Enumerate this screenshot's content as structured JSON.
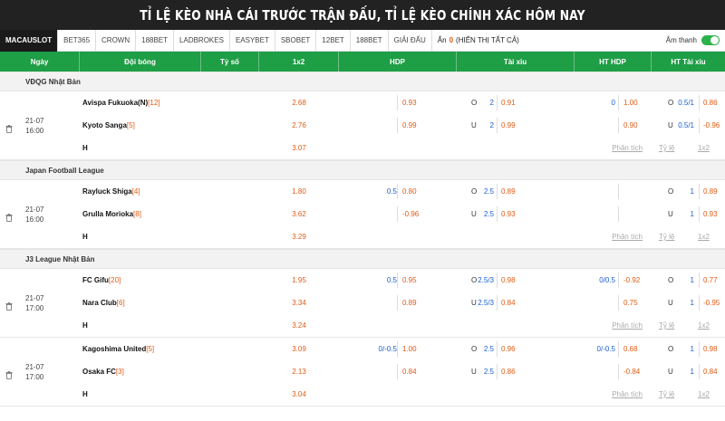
{
  "title": "TỈ LỆ KÈO NHÀ CÁI TRƯỚC TRẬN ĐẤU, TỈ LỆ KÈO CHÍNH XÁC HÔM NAY",
  "tabs": [
    "MACAUSLOT",
    "BET365",
    "CROWN",
    "188BET",
    "LADBROKES",
    "EASYBET",
    "SBOBET",
    "12BET",
    "188BET",
    "GIẢI ĐẤU"
  ],
  "hidden": {
    "label_pre": "Ẩn",
    "count": "0",
    "label_post": "(HIỂN THỊ TẤT CẢ)"
  },
  "sound_label": "Âm thanh",
  "headers": {
    "date": "Ngày",
    "team": "Đội bóng",
    "score": "Tỷ số",
    "x12": "1x2",
    "hdp": "HDP",
    "ou": "Tài xỉu",
    "hthdp": "HT HDP",
    "htou": "HT Tài xỉu"
  },
  "links": {
    "analysis": "Phân tích",
    "history": "Tỷ lệ",
    "x12": "1x2"
  },
  "leagues": [
    {
      "name": "VĐQG Nhật Bản",
      "matches": [
        {
          "date": "21-07",
          "time": "16:00",
          "home": "Avispa Fukuoka(N)",
          "home_rank": "[12]",
          "away": "Kyoto Sanga",
          "away_rank": "[5]",
          "x12": [
            "2.68",
            "2.76",
            "3.07"
          ],
          "hdp": {
            "home_line": "",
            "home_odd": "0.93",
            "away_line": "",
            "away_odd": "0.99"
          },
          "ou": {
            "line": "2",
            "over_lbl": "O",
            "over": "0.91",
            "under_lbl": "U",
            "under": "0.99"
          },
          "hthdp": {
            "home_line": "0",
            "home_odd": "1.00",
            "away_line": "",
            "away_odd": "0.90"
          },
          "htou": {
            "line": "0.5/1",
            "over_lbl": "O",
            "over": "0.86",
            "under_lbl": "U",
            "under": "-0.96"
          }
        }
      ]
    },
    {
      "name": "Japan Football League",
      "matches": [
        {
          "date": "21-07",
          "time": "16:00",
          "home": "Rayluck Shiga",
          "home_rank": "[4]",
          "away": "Grulla Morioka",
          "away_rank": "[8]",
          "x12": [
            "1.80",
            "3.62",
            "3.29"
          ],
          "hdp": {
            "home_line": "0.5",
            "home_odd": "0.80",
            "away_line": "",
            "away_odd": "-0.96"
          },
          "ou": {
            "line": "2.5",
            "over_lbl": "O",
            "over": "0.89",
            "under_lbl": "U",
            "under": "0.93"
          },
          "hthdp": {
            "home_line": "",
            "home_odd": "",
            "away_line": "",
            "away_odd": ""
          },
          "htou": {
            "line": "1",
            "over_lbl": "O",
            "over": "0.89",
            "under_lbl": "U",
            "under": "0.93"
          }
        }
      ]
    },
    {
      "name": "J3 League Nhật Bản",
      "matches": [
        {
          "date": "21-07",
          "time": "17:00",
          "home": "FC Gifu",
          "home_rank": "[20]",
          "away": "Nara Club",
          "away_rank": "[6]",
          "x12": [
            "1.95",
            "3.34",
            "3.24"
          ],
          "hdp": {
            "home_line": "0.5",
            "home_odd": "0.95",
            "away_line": "",
            "away_odd": "0.89"
          },
          "ou": {
            "line": "2.5/3",
            "over_lbl": "O",
            "over": "0.98",
            "under_lbl": "U",
            "under": "0.84"
          },
          "hthdp": {
            "home_line": "0/0.5",
            "home_odd": "-0.92",
            "away_line": "",
            "away_odd": "0.75"
          },
          "htou": {
            "line": "1",
            "over_lbl": "O",
            "over": "0.77",
            "under_lbl": "U",
            "under": "-0.95"
          }
        },
        {
          "date": "21-07",
          "time": "17:00",
          "home": "Kagoshima United",
          "home_rank": "[5]",
          "away": "Osaka FC",
          "away_rank": "[3]",
          "x12": [
            "3.09",
            "2.13",
            "3.04"
          ],
          "hdp": {
            "home_line": "0/-0.5",
            "home_odd": "1.00",
            "away_line": "",
            "away_odd": "0.84"
          },
          "ou": {
            "line": "2.5",
            "over_lbl": "O",
            "over": "0.96",
            "under_lbl": "U",
            "under": "0.86"
          },
          "hthdp": {
            "home_line": "0/-0.5",
            "home_odd": "0.68",
            "away_line": "",
            "away_odd": "-0.84"
          },
          "htou": {
            "line": "1",
            "over_lbl": "O",
            "over": "0.98",
            "under_lbl": "U",
            "under": "0.84"
          }
        }
      ]
    }
  ],
  "colors": {
    "header_green": "#1e9e45",
    "odd_orange": "#e05a14",
    "line_blue": "#1a5fd1",
    "title_bg": "#222222"
  }
}
